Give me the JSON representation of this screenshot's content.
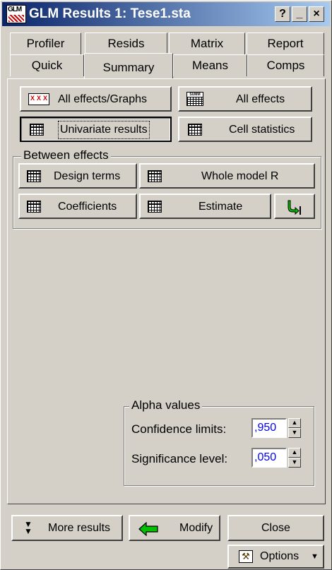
{
  "window": {
    "icon_text": "GLM",
    "title": "GLM Results 1: Tese1.sta",
    "help_btn": "?",
    "min_btn": "_",
    "close_btn": "×"
  },
  "tabs_top": [
    "Profiler",
    "Resids",
    "Matrix",
    "Report"
  ],
  "tabs_bottom": [
    "Quick",
    "Summary",
    "Means",
    "Comps"
  ],
  "active_tab": "Summary",
  "summary": {
    "all_effects_graphs": "All effects/Graphs",
    "all_effects": "All effects",
    "univariate_results": "Univariate results",
    "cell_statistics": "Cell statistics"
  },
  "between_effects": {
    "label": "Between effects",
    "design_terms": "Design terms",
    "whole_model_r": "Whole model R",
    "coefficients": "Coefficients",
    "estimate": "Estimate"
  },
  "alpha": {
    "label": "Alpha values",
    "confidence_label": "Confidence limits:",
    "confidence_value": ",950",
    "significance_label": "Significance level:",
    "significance_value": ",050"
  },
  "footer": {
    "more_results": "More results",
    "modify": "Modify",
    "close": "Close",
    "options": "Options"
  },
  "icons": {
    "more_results": "double-chevron-down-icon",
    "modify": "green-left-arrow-icon",
    "options": "gavel-icon",
    "estimate_extra": "green-arrow-down-icon"
  },
  "colors": {
    "title_start": "#0a246a",
    "title_end": "#a6caf0",
    "face": "#d4d0c8",
    "input_text": "#0000ff",
    "arrow_green": "#00c000"
  }
}
